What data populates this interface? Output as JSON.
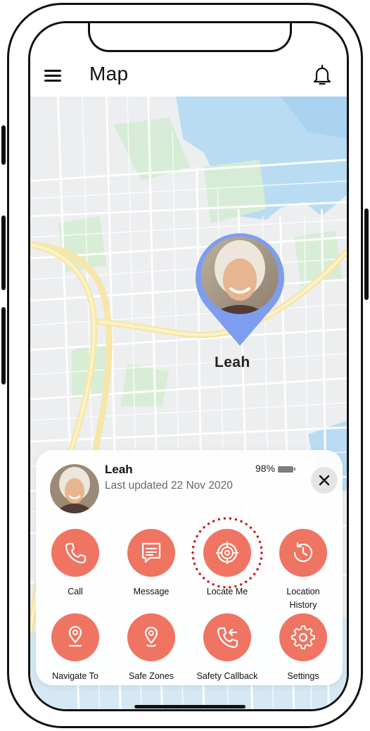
{
  "header": {
    "title": "Map",
    "menu_icon": "hamburger-menu-icon",
    "bell_icon": "bell-icon"
  },
  "map": {
    "marker_label": "Leah",
    "marker_color": "#7f9dee"
  },
  "card": {
    "name": "Leah",
    "battery": "98%",
    "last_updated": "Last updated 22 Nov 2020",
    "close_icon": "close-icon"
  },
  "actions": [
    {
      "label": "Call",
      "icon": "phone-icon"
    },
    {
      "label": "Message",
      "icon": "message-icon"
    },
    {
      "label": "Locate Me",
      "icon": "target-icon"
    },
    {
      "label": "Location History",
      "label_line1": "Location",
      "label_line2": "History",
      "icon": "history-clock-icon"
    },
    {
      "label": "Navigate To",
      "icon": "navigate-pin-icon"
    },
    {
      "label": "Safe Zones",
      "icon": "location-pin-icon"
    },
    {
      "label": "Safety Callback",
      "icon": "callback-phone-icon"
    },
    {
      "label": "Settings",
      "icon": "gear-icon"
    }
  ],
  "colors": {
    "accent": "#f07462",
    "marker": "#7f9dee",
    "dotted_ring": "#cc1f2b"
  }
}
